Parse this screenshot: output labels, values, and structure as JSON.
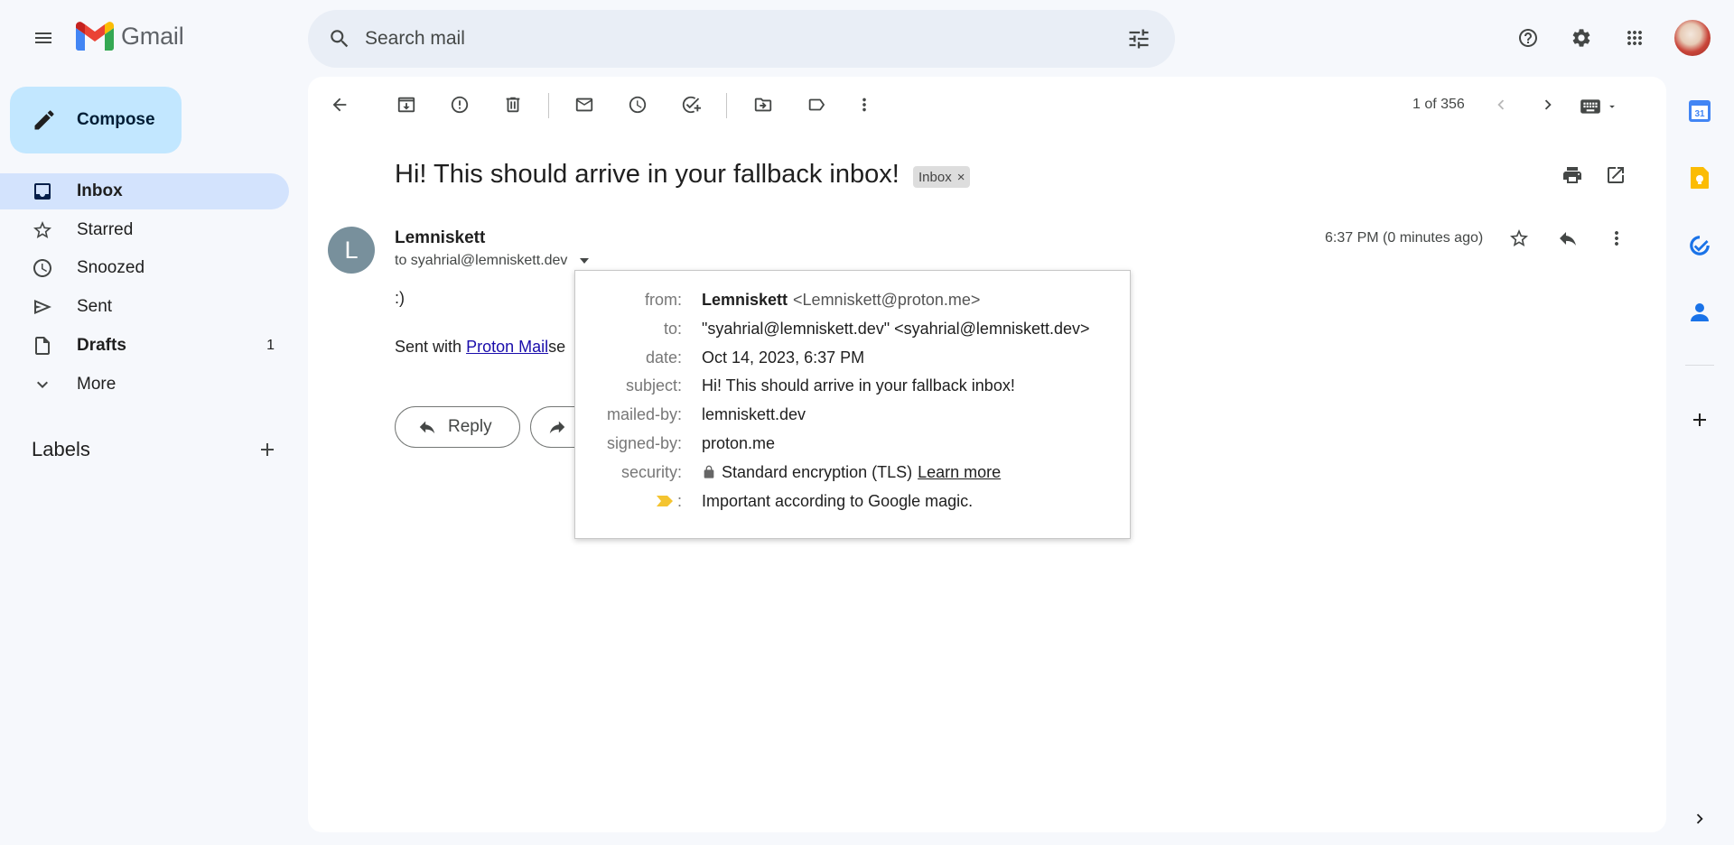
{
  "app": {
    "name": "Gmail"
  },
  "search": {
    "placeholder": "Search mail"
  },
  "compose": {
    "label": "Compose"
  },
  "nav": {
    "items": [
      {
        "label": "Inbox",
        "count": ""
      },
      {
        "label": "Starred",
        "count": ""
      },
      {
        "label": "Snoozed",
        "count": ""
      },
      {
        "label": "Sent",
        "count": ""
      },
      {
        "label": "Drafts",
        "count": "1"
      },
      {
        "label": "More",
        "count": ""
      }
    ]
  },
  "labels": {
    "title": "Labels"
  },
  "toolbar": {
    "counter": "1 of 356"
  },
  "message": {
    "subject": "Hi! This should arrive in your fallback inbox!",
    "chip": "Inbox",
    "chip_close": "×",
    "avatar_letter": "L",
    "sender": "Lemniskett",
    "to_line": "to syahrial@lemniskett.dev",
    "time": "6:37 PM (0 minutes ago)",
    "body": ":)",
    "sig_prefix": "Sent with",
    "sig_link": "Proton Mail",
    "sig_suffix": "se"
  },
  "actions": {
    "reply": "Reply"
  },
  "details": {
    "from_key": "from:",
    "from_name": "Lemniskett",
    "from_email": "<Lemniskett@proton.me>",
    "to_key": "to:",
    "to_value": "\"syahrial@lemniskett.dev\" <syahrial@lemniskett.dev>",
    "date_key": "date:",
    "date_value": "Oct 14, 2023, 6:37 PM",
    "subject_key": "subject:",
    "subject_value": "Hi! This should arrive in your fallback inbox!",
    "mailedby_key": "mailed-by:",
    "mailedby_value": "lemniskett.dev",
    "signedby_key": "signed-by:",
    "signedby_value": "proton.me",
    "security_key": "security:",
    "security_value": "Standard encryption (TLS)",
    "security_link": "Learn more",
    "important_key": ":",
    "important_value": "Important according to Google magic."
  },
  "rail": {
    "calendar_day": "31"
  },
  "colors": {
    "accent": "#0b57d0",
    "compose_bg": "#c2e7ff",
    "active_nav": "#d3e3fd",
    "important_marker": "#f4c430"
  }
}
